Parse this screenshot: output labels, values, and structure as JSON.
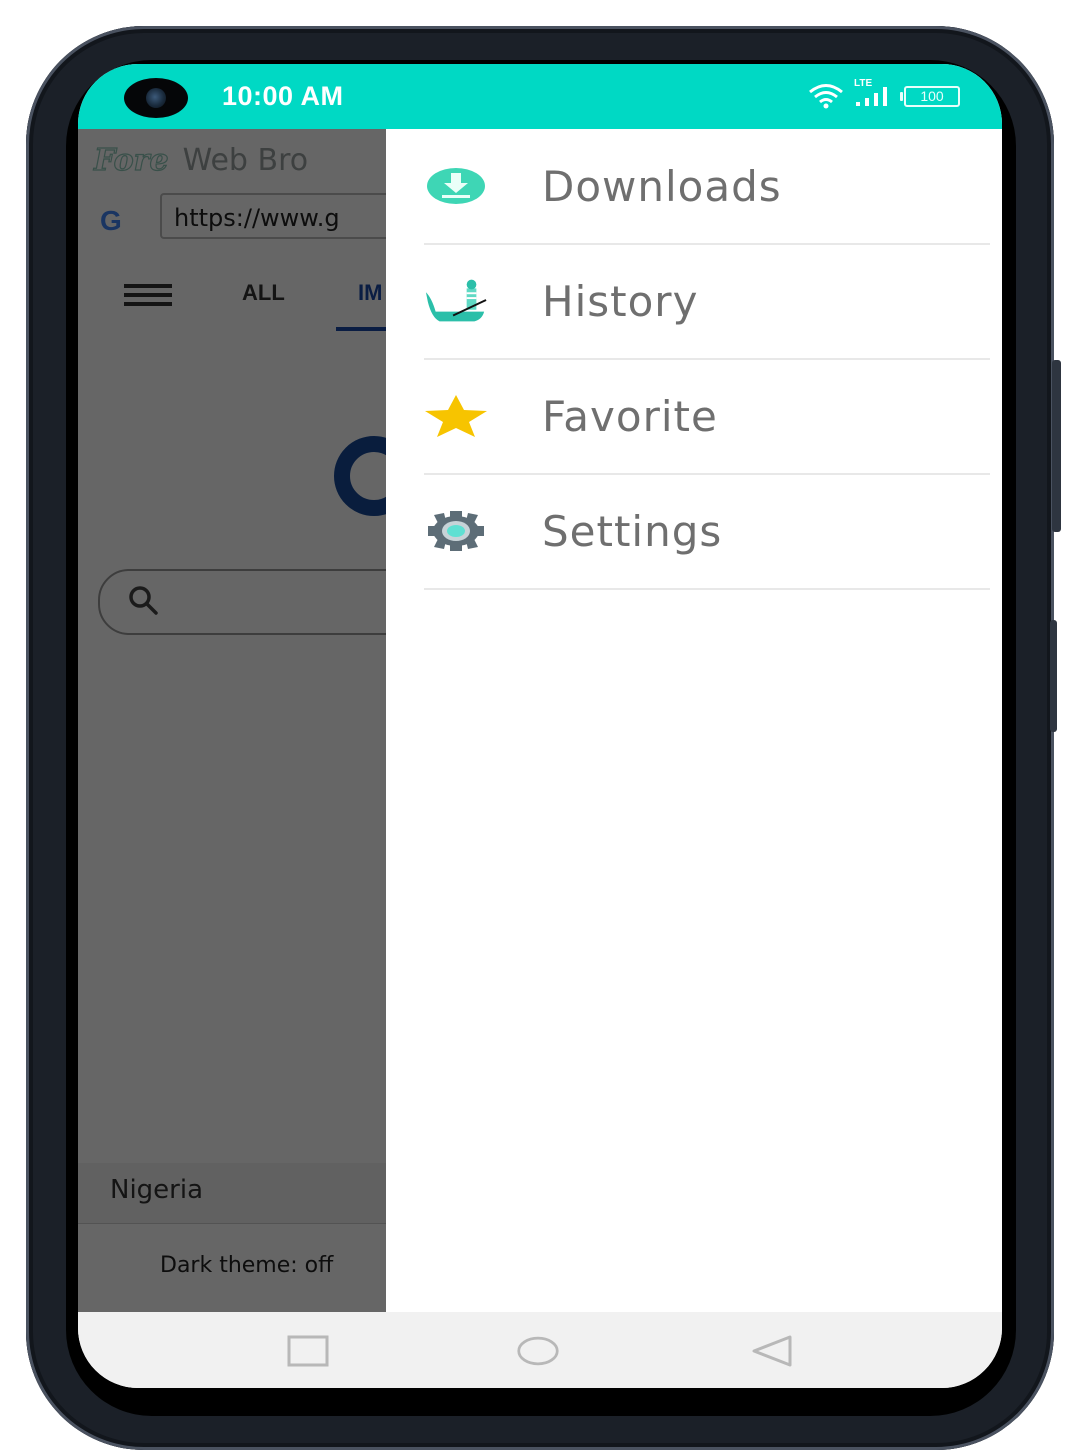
{
  "status_bar": {
    "time": "10:00 AM",
    "network_label": "LTE",
    "battery_level": "100",
    "accent_color": "#00d9c4"
  },
  "browser": {
    "brand_fore": "Fore",
    "brand_rest": "Web Bro",
    "search_engine_logo": "G",
    "url": "https://www.g",
    "tabs": [
      {
        "label": "ALL",
        "active": false
      },
      {
        "label": "IM",
        "active": true
      }
    ],
    "country": "Nigeria",
    "dark_theme": "Dark theme: off"
  },
  "drawer": {
    "items": [
      {
        "label": "Downloads",
        "icon": "download-icon",
        "color": "#3ed6b5"
      },
      {
        "label": "History",
        "icon": "gondola-boat-icon",
        "color": "#2bbfa9"
      },
      {
        "label": "Favorite",
        "icon": "star-icon",
        "color": "#f7c400"
      },
      {
        "label": "Settings",
        "icon": "gear-icon",
        "color": "#5d6d77"
      }
    ]
  },
  "nav_bar": {
    "buttons": [
      {
        "name": "recents",
        "icon": "square-icon"
      },
      {
        "name": "home",
        "icon": "circle-icon"
      },
      {
        "name": "back",
        "icon": "triangle-back-icon"
      }
    ]
  }
}
